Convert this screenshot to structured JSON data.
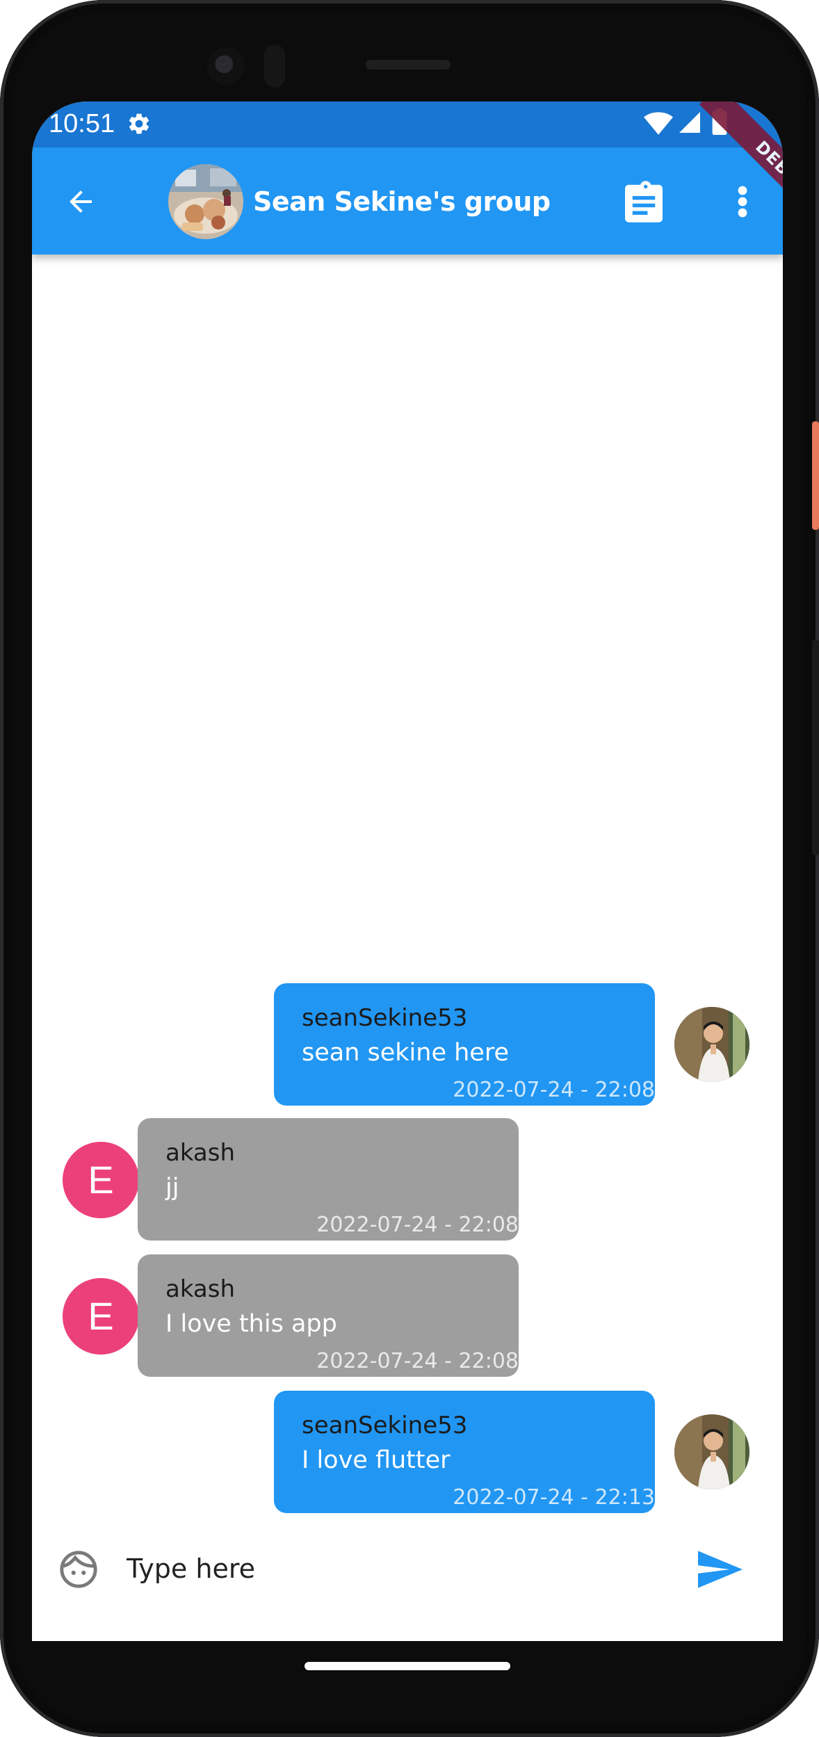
{
  "status_bar": {
    "time": "10:51",
    "icons": [
      "gear-icon",
      "wifi-icon",
      "signal-icon",
      "battery-icon"
    ]
  },
  "app_bar": {
    "title": "Sean Sekine's group",
    "actions": [
      "back-arrow-icon",
      "clipboard-icon",
      "more-vert-icon"
    ],
    "debug_banner": "DEBUG"
  },
  "messages": [
    {
      "sender": "seanSekine53",
      "text": "sean sekine here",
      "time": "2022-07-24 - 22:08",
      "direction": "sent",
      "avatar": "photo"
    },
    {
      "sender": "akash",
      "text": "jj",
      "time": "2022-07-24 - 22:08",
      "direction": "received",
      "avatar_letter": "E"
    },
    {
      "sender": "akash",
      "text": "I love this app",
      "time": "2022-07-24 - 22:08",
      "direction": "received",
      "avatar_letter": "E"
    },
    {
      "sender": "seanSekine53",
      "text": "I love flutter",
      "time": "2022-07-24 - 22:13",
      "direction": "sent",
      "avatar": "photo"
    }
  ],
  "composer": {
    "placeholder": "Type here",
    "value": "",
    "emoji_icon": "face-icon",
    "send_icon": "send-icon"
  },
  "colors": {
    "primary": "#2196f3",
    "primary_dark": "#1976d2",
    "received_bubble": "#9e9e9e",
    "letter_avatar": "#ec407a",
    "debug_ribbon": "#7b1b39"
  }
}
